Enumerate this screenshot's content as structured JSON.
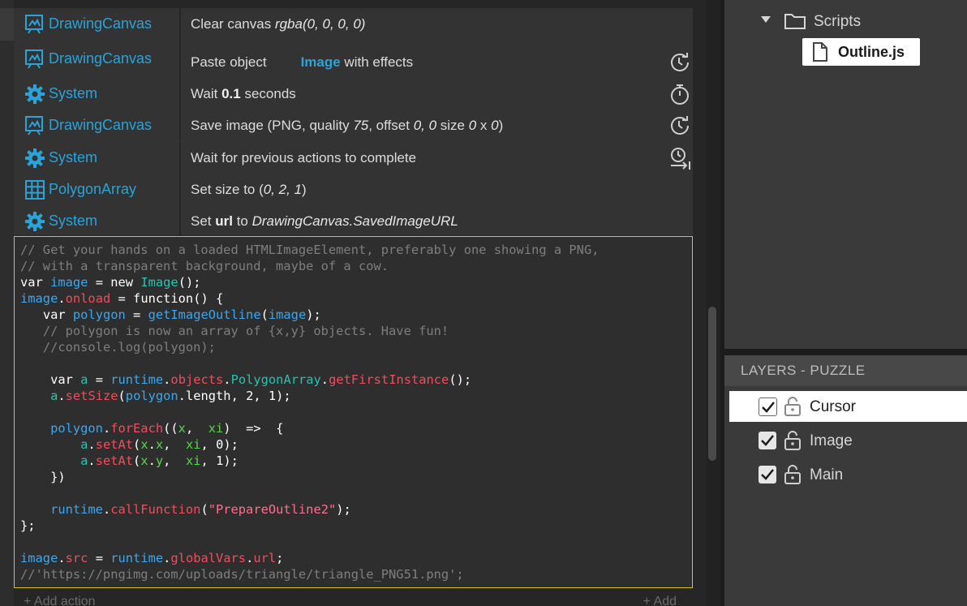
{
  "events": {
    "rows": [
      {
        "object": "DrawingCanvas",
        "icon": "drawing-canvas-icon",
        "action": {
          "a": "Clear canvas ",
          "i": "rgba(0, 0, 0, 0)"
        },
        "right_icon": ""
      },
      {
        "object": "DrawingCanvas",
        "icon": "drawing-canvas-icon",
        "action": {
          "a": "Paste object",
          "hl": "Image",
          "c": " with effects"
        },
        "right_icon": "async-icon"
      },
      {
        "object": "System",
        "icon": "system-gear-icon",
        "action": {
          "a": "Wait ",
          "b": "0.1",
          "c": " seconds"
        },
        "right_icon": "stopwatch-icon"
      },
      {
        "object": "DrawingCanvas",
        "icon": "drawing-canvas-icon",
        "action": {
          "a": "Save image (PNG, quality ",
          "i1": "75",
          "b": ", offset ",
          "i2": "0, 0",
          "c": " size ",
          "i3": "0",
          "d": " x ",
          "i4": "0",
          "e": ")"
        },
        "right_icon": "async-icon"
      },
      {
        "object": "System",
        "icon": "system-gear-icon",
        "action": {
          "a": "Wait for previous actions to complete"
        },
        "right_icon": "wait-previous-icon"
      },
      {
        "object": "PolygonArray",
        "icon": "array-grid-icon",
        "action": {
          "a": "Set size to (",
          "i": "0, 2, 1",
          "c": ")"
        },
        "right_icon": ""
      },
      {
        "object": "System",
        "icon": "system-gear-icon",
        "action": {
          "a": "Set ",
          "b": "url",
          "c": " to ",
          "i": "DrawingCanvas.SavedImageURL"
        },
        "right_icon": ""
      }
    ],
    "add_action_label": "+ Add action",
    "add_label": "+ Add"
  },
  "script_code": "// Get your hands on a loaded HTMLImageElement, preferably one showing a PNG,\n// with a transparent background, maybe of a cow.\nvar image = new Image();\nimage.onload = function() {\n   var polygon = getImageOutline(image);\n   // polygon is now an array of {x,y} objects. Have fun!\n   //console.log(polygon);\n\n    var a = runtime.objects.PolygonArray.getFirstInstance();\n    a.setSize(polygon.length, 2, 1);\n\n    polygon.forEach((x,  xi)  =>  {\n        a.setAt(x.x,  xi, 0);\n        a.setAt(x.y,  xi, 1);\n    })\n\n    runtime.callFunction(\"PrepareOutline2\");\n};\n\nimage.src = runtime.globalVars.url;\n//'https://pngimg.com/uploads/triangle/triangle_PNG51.png';",
  "project": {
    "folder": "Scripts",
    "file": "Outline.js"
  },
  "layers": {
    "title": "LAYERS - PUZZLE",
    "items": [
      {
        "name": "Cursor",
        "checked": true,
        "locked": false,
        "selected": true
      },
      {
        "name": "Image",
        "checked": true,
        "locked": false,
        "selected": false
      },
      {
        "name": "Main",
        "checked": true,
        "locked": false,
        "selected": false
      }
    ]
  },
  "colors": {
    "accent": "#2aa3d8",
    "code_border": "#d8c12d"
  }
}
